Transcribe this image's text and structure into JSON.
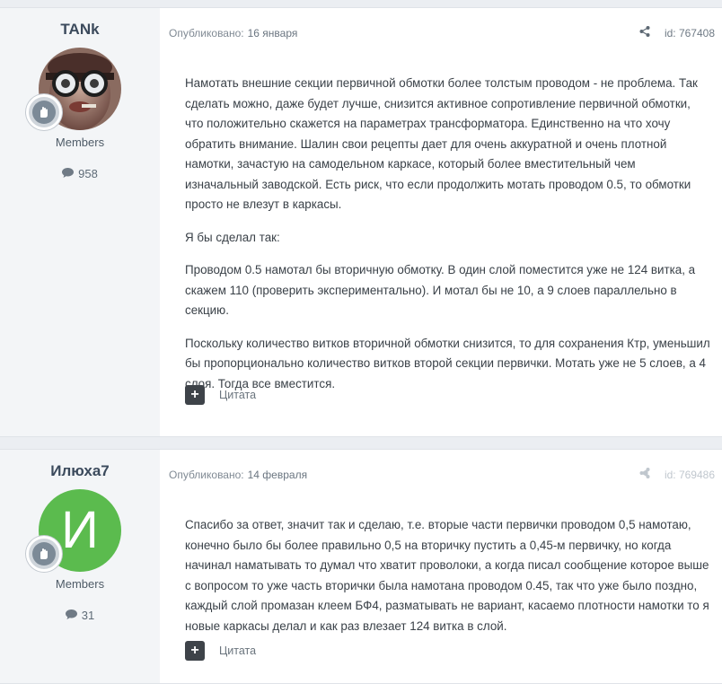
{
  "posts": [
    {
      "author": "TANk",
      "group": "Members",
      "post_count": "958",
      "published_label": "Опубликовано:",
      "date": "16 января",
      "id": "id: 767408",
      "paragraphs": [
        "Намотать внешние секции первичной обмотки более толстым проводом - не проблема. Так сделать можно, даже будет лучше, снизится активное сопротивление первичной обмотки, что положительно скажется на параметрах трансформатора. Единственно на что хочу обратить внимание. Шалин свои рецепты дает для очень аккуратной и очень плотной намотки, зачастую на самодельном каркасе, который более вместительный чем изначальный заводской. Есть риск, что если продолжить мотать проводом 0.5, то обмотки просто не влезут в каркасы.",
        "Я бы сделал так:",
        "Проводом 0.5 намотал бы вторичную обмотку. В один слой поместится уже не 124 витка, а скажем 110 (проверить экспериментально). И мотал бы не 10, а 9 слоев параллельно в секцию.",
        "Поскольку количество витков вторичной обмотки снизится, то для сохранения Ктр, уменьшил бы пропорционально количество витков второй секции первички. Мотать уже не 5 слоев, а 4 слоя. Тогда все вместится."
      ],
      "quote_label": "Цитата"
    },
    {
      "author": "Илюха7",
      "avatar_letter": "И",
      "group": "Members",
      "post_count": "31",
      "published_label": "Опубликовано:",
      "date": "14 февраля",
      "id": "id: 769486",
      "paragraphs": [
        "Спасибо за ответ, значит так и сделаю, т.е. вторые части первички проводом 0,5 намотаю, конечно было бы более правильно 0,5 на вторичку пустить а 0,45-м первичку, но когда начинал наматывать то думал что хватит проволоки, а когда писал сообщение которое выше с вопросом то уже часть вторички была намотана проводом 0.45, так что уже было поздно, каждый слой промазан клеем БФ4, разматывать не вариант, касаемо плотности намотки то я новые каркасы делал и как раз влезает 124 витка в слой."
      ],
      "quote_label": "Цитата"
    }
  ],
  "icons": {
    "share": "share-icon",
    "comment": "comment-icon",
    "rank": "rank-badge-icon",
    "quote": "plus-icon"
  },
  "colors": {
    "avatar_green": "#5bbb4e",
    "quote_button": "#3e4349",
    "author_panel": "#f3f5f7"
  }
}
